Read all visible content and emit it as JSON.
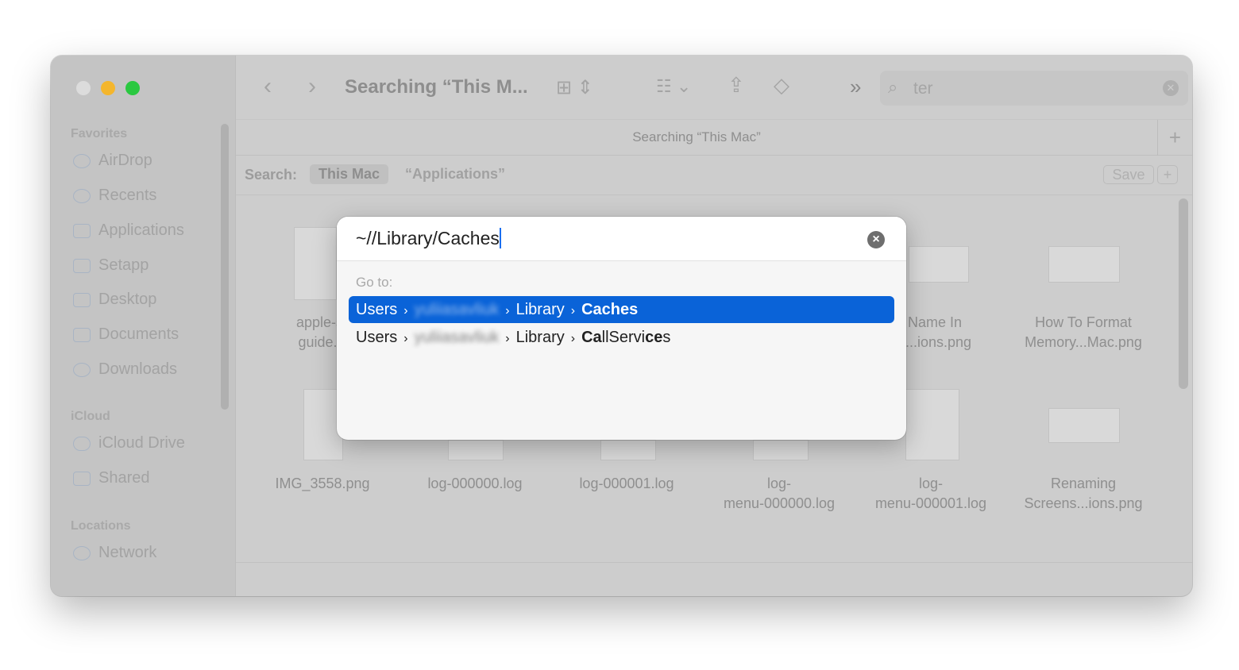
{
  "window": {
    "traffic_lights": {
      "close": "#dcdcdc",
      "minimize": "#f4b62d",
      "zoom": "#2ac840"
    }
  },
  "toolbar": {
    "title": "Searching “This M...",
    "search_value": "ter"
  },
  "tab": {
    "label": "Searching “This Mac”",
    "add": "+"
  },
  "scope": {
    "label": "Search:",
    "this_mac": "This Mac",
    "applications": "“Applications”",
    "save": "Save",
    "add": "+"
  },
  "sidebar": {
    "sections": [
      {
        "title": "Favorites",
        "items": [
          "AirDrop",
          "Recents",
          "Applications",
          "Setapp",
          "Desktop",
          "Documents",
          "Downloads"
        ]
      },
      {
        "title": "iCloud",
        "items": [
          "iCloud Drive",
          "Shared"
        ]
      },
      {
        "title": "Locations",
        "items": [
          "Network"
        ]
      }
    ]
  },
  "files": {
    "row1": [
      {
        "l1": "apple-st",
        "l2": "guide.p"
      },
      {
        "l1": "t Name In",
        "l2": "ns...ions.png"
      },
      {
        "l1": "How To Format",
        "l2": "Memory...Mac.png"
      }
    ],
    "row2": [
      {
        "l1": "IMG_3558.png",
        "l2": ""
      },
      {
        "l1": "log-000000.log",
        "l2": ""
      },
      {
        "l1": "log-000001.log",
        "l2": ""
      },
      {
        "l1": "log-",
        "l2": "menu-000000.log"
      },
      {
        "l1": "log-",
        "l2": "menu-000001.log"
      },
      {
        "l1": "Renaming",
        "l2": "Screens...ions.png"
      }
    ]
  },
  "dialog": {
    "path_value": "~//Library/Caches",
    "goto_label": "Go to:",
    "suggestions": [
      {
        "parts": [
          "Users",
          "yuliiasavliuk",
          "Library"
        ],
        "match_bold": "Caches",
        "rest": "",
        "selected": true
      },
      {
        "parts": [
          "Users",
          "yuliiasavliuk",
          "Library"
        ],
        "match_bold": "Ca",
        "rest": "llServi",
        "bold2": "ce",
        "rest2": "s",
        "selected": false
      }
    ],
    "separator": "›",
    "accent": "#0a63d8"
  }
}
